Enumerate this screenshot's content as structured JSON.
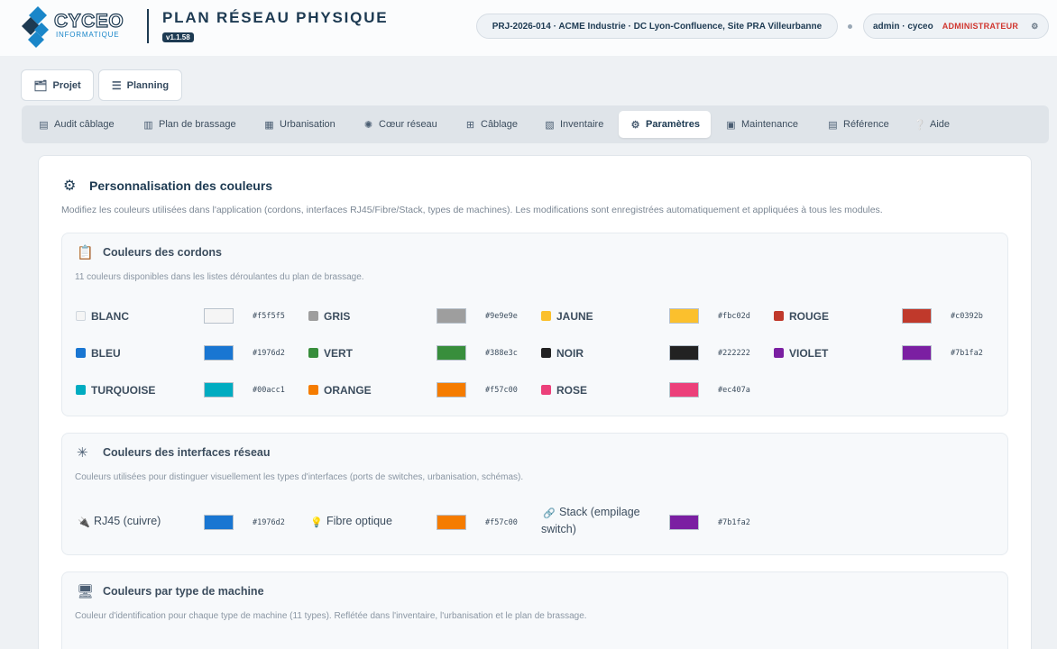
{
  "header": {
    "logo_name": "CYCEO",
    "logo_sub": "INFORMATIQUE",
    "app_title": "PLAN RÉSEAU PHYSIQUE",
    "version": "v1.1.58",
    "project": "PRJ-2026-014 · ACME Industrie · DC Lyon-Confluence, Site PRA Villeurbanne",
    "user": "admin · cyceo",
    "role": "ADMINISTRATEUR"
  },
  "top_buttons": {
    "projet": "Projet",
    "planning": "Planning"
  },
  "nav": [
    {
      "label": "Audit câblage",
      "icon": "audit-icon"
    },
    {
      "label": "Plan de brassage",
      "icon": "patch-plan-icon"
    },
    {
      "label": "Urbanisation",
      "icon": "rack-icon"
    },
    {
      "label": "Cœur réseau",
      "icon": "network-core-icon"
    },
    {
      "label": "Câblage",
      "icon": "cable-icon"
    },
    {
      "label": "Inventaire",
      "icon": "inventory-icon"
    },
    {
      "label": "Paramètres",
      "icon": "gear-icon"
    },
    {
      "label": "Maintenance",
      "icon": "maintenance-icon"
    },
    {
      "label": "Référence",
      "icon": "reference-icon"
    },
    {
      "label": "Aide",
      "icon": "help-icon"
    }
  ],
  "active_nav": "Paramètres",
  "main": {
    "title": "Personnalisation des couleurs",
    "description": "Modifiez les couleurs utilisées dans l'application (cordons, interfaces RJ45/Fibre/Stack, types de machines). Les modifications sont enregistrées automatiquement et appliquées à tous les modules."
  },
  "cordons": {
    "title": "Couleurs des cordons",
    "description": "11 couleurs disponibles dans les listes déroulantes du plan de brassage.",
    "items": [
      {
        "name": "BLANC",
        "hex": "#f5f5f5"
      },
      {
        "name": "GRIS",
        "hex": "#9e9e9e"
      },
      {
        "name": "JAUNE",
        "hex": "#fbc02d"
      },
      {
        "name": "ROUGE",
        "hex": "#c0392b"
      },
      {
        "name": "BLEU",
        "hex": "#1976d2"
      },
      {
        "name": "VERT",
        "hex": "#388e3c"
      },
      {
        "name": "NOIR",
        "hex": "#222222"
      },
      {
        "name": "VIOLET",
        "hex": "#7b1fa2"
      },
      {
        "name": "TURQUOISE",
        "hex": "#00acc1"
      },
      {
        "name": "ORANGE",
        "hex": "#f57c00"
      },
      {
        "name": "ROSE",
        "hex": "#ec407a"
      }
    ]
  },
  "interfaces": {
    "title": "Couleurs des interfaces réseau",
    "description": "Couleurs utilisées pour distinguer visuellement les types d'interfaces (ports de switches, urbanisation, schémas).",
    "items": [
      {
        "name": "RJ45 (cuivre)",
        "hex": "#1976d2",
        "icon": "rj45-plug-icon"
      },
      {
        "name": "Fibre optique",
        "hex": "#f57c00",
        "icon": "bulb-icon"
      },
      {
        "name": "Stack (empilage switch)",
        "hex": "#7b1fa2",
        "icon": "link-icon"
      }
    ]
  },
  "machines": {
    "title": "Couleurs par type de machine",
    "description": "Couleur d'identification pour chaque type de machine (11 types). Reflétée dans l'inventaire, l'urbanisation et le plan de brassage."
  }
}
